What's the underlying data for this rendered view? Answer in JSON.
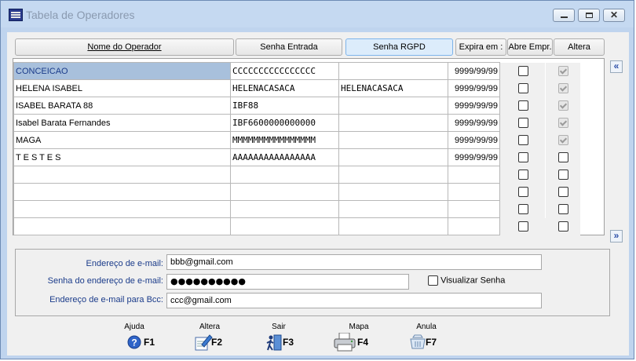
{
  "window": {
    "title": "Tabela de Operadores"
  },
  "columns": {
    "name": "Nome do Operador",
    "entry_password": "Senha Entrada",
    "rgpd_password": "Senha RGPD",
    "expires": "Expira em :",
    "open_company": "Abre Empr.",
    "change_password": "Altera Senha"
  },
  "rows": [
    {
      "name": "CONCEICAO",
      "entry": "CCCCCCCCCCCCCCCC",
      "rgpd": "",
      "expires": "9999/99/99",
      "open_company": false,
      "change_password": true
    },
    {
      "name": "HELENA ISABEL",
      "entry": "HELENACASACA",
      "rgpd": "HELENACASACA",
      "expires": "9999/99/99",
      "open_company": false,
      "change_password": true
    },
    {
      "name": "ISABEL BARATA 88",
      "entry": "IBF88",
      "rgpd": "",
      "expires": "9999/99/99",
      "open_company": false,
      "change_password": true
    },
    {
      "name": "Isabel Barata Fernandes",
      "entry": "IBF6600000000000",
      "rgpd": "",
      "expires": "9999/99/99",
      "open_company": false,
      "change_password": true
    },
    {
      "name": "MAGA",
      "entry": "MMMMMMMMMMMMMMMM",
      "rgpd": "",
      "expires": "9999/99/99",
      "open_company": false,
      "change_password": true
    },
    {
      "name": "T E S T E S",
      "entry": "AAAAAAAAAAAAAAAA",
      "rgpd": "",
      "expires": "9999/99/99",
      "open_company": false,
      "change_password": false
    },
    {
      "name": "",
      "entry": "",
      "rgpd": "",
      "expires": "",
      "open_company": false,
      "change_password": false
    },
    {
      "name": "",
      "entry": "",
      "rgpd": "",
      "expires": "",
      "open_company": false,
      "change_password": false
    },
    {
      "name": "",
      "entry": "",
      "rgpd": "",
      "expires": "",
      "open_company": false,
      "change_password": false
    },
    {
      "name": "",
      "entry": "",
      "rgpd": "",
      "expires": "",
      "open_company": false,
      "change_password": false
    }
  ],
  "email": {
    "address_label": "Endereço de e-mail:",
    "address_value": "bbb@gmail.com",
    "password_label": "Senha do endereço de e-mail:",
    "password_value": "●●●●●●●●●●",
    "show_password_label": "Visualizar Senha",
    "bcc_label": "Endereço de e-mail para Bcc:",
    "bcc_value": "ccc@gmail.com"
  },
  "toolbar": [
    {
      "caption": "Ajuda",
      "key": "F1",
      "icon": "help-icon"
    },
    {
      "caption": "Altera",
      "key": "F2",
      "icon": "edit-icon"
    },
    {
      "caption": "Sair",
      "key": "F3",
      "icon": "exit-icon"
    },
    {
      "caption": "Mapa",
      "key": "F4",
      "icon": "printer-icon"
    },
    {
      "caption": "Anula",
      "key": "F7",
      "icon": "cancel-icon"
    }
  ],
  "scroll": {
    "up_glyph": "«",
    "down_glyph": "»"
  }
}
